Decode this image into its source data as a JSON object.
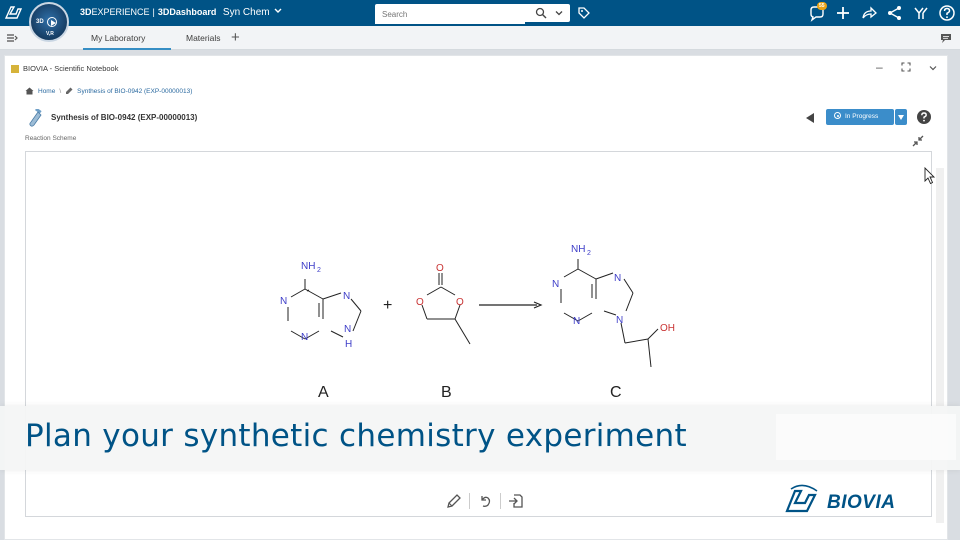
{
  "topbar": {
    "brand_prefix": "3D",
    "brand_experience": "EXPERIENCE",
    "brand_separator": "|",
    "brand_app": "3DDashboard",
    "context": "Syn Chem",
    "compass_3d": "3D",
    "compass_vr": "V,R",
    "search_placeholder": "Search",
    "notification_count": "55"
  },
  "tabs": [
    {
      "label": "My Laboratory",
      "active": true
    },
    {
      "label": "Materials",
      "active": false
    }
  ],
  "panel": {
    "title": "BIOVIA - Scientific Notebook",
    "breadcrumb": {
      "home": "Home",
      "current": "Synthesis of BIO-0942 (EXP-00000013)"
    },
    "experiment_title": "Synthesis of BIO-0942 (EXP-00000013)",
    "status_label": "In Progress",
    "section_label": "Reaction Scheme"
  },
  "reaction": {
    "plus": "+",
    "compounds": [
      {
        "label": "A",
        "atoms": {
          "amine": "NH",
          "amine_sub": "2",
          "n1": "N",
          "n3": "N",
          "n7": "N",
          "n9": "N",
          "h9": "H"
        }
      },
      {
        "label": "B",
        "atoms": {
          "o_carbonyl": "O",
          "o_left": "O",
          "o_right": "O"
        }
      },
      {
        "label": "C",
        "atoms": {
          "amine": "NH",
          "amine_sub": "2",
          "n1": "N",
          "n3": "N",
          "n7": "N",
          "n9": "N",
          "oh": "OH"
        }
      }
    ]
  },
  "banner": {
    "text": "Plan your synthetic chemistry experiment"
  },
  "logo": {
    "text": "BIOVIA"
  },
  "colors": {
    "topbar": "#005386",
    "accent": "#3b8dca",
    "nitrogen": "#3d3dc8",
    "oxygen": "#c83232",
    "banner_text": "#005386"
  }
}
